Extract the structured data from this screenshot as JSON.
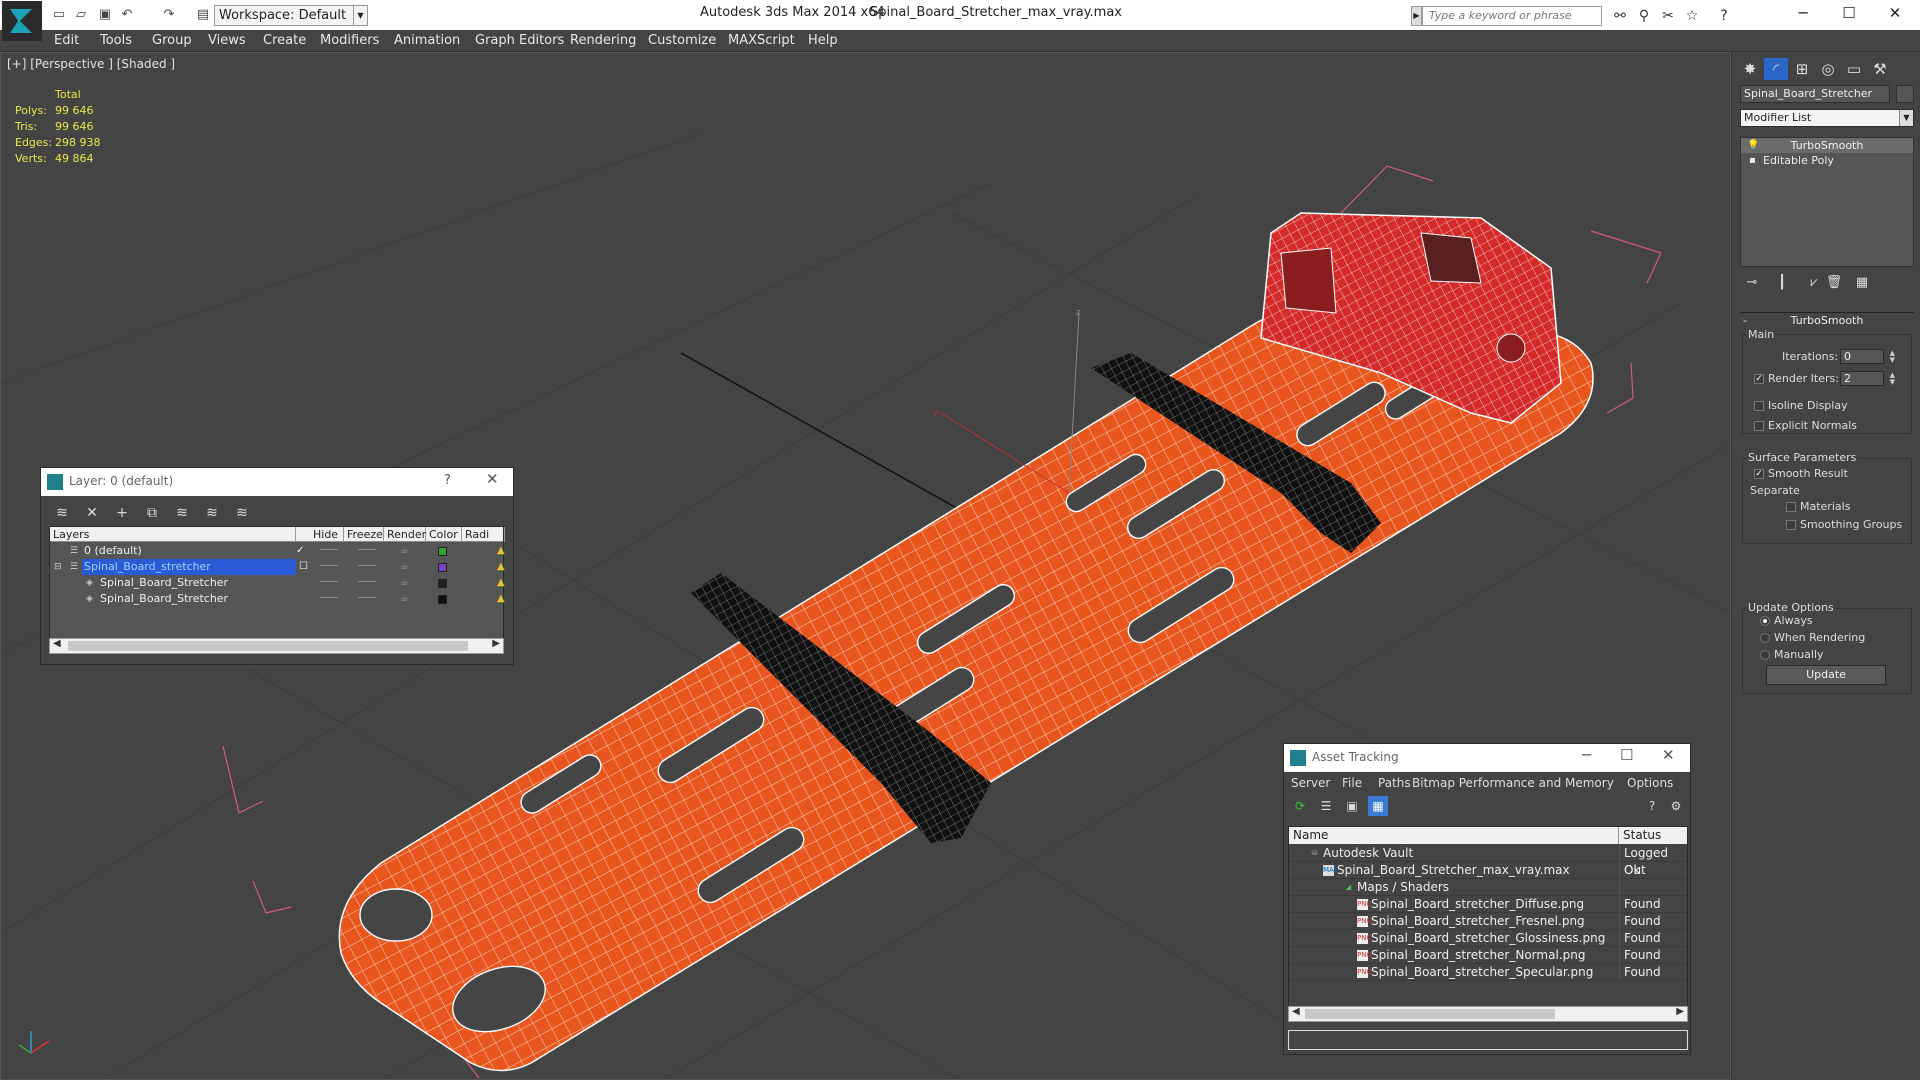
{
  "titlebar": {
    "app_title": "Autodesk 3ds Max  2014 x64",
    "file_title": "Spinal_Board_Stretcher_max_vray.max",
    "workspace": "Workspace: Default",
    "search_placeholder": "Type a keyword or phrase"
  },
  "menu": [
    "Edit",
    "Tools",
    "Group",
    "Views",
    "Create",
    "Modifiers",
    "Animation",
    "Graph Editors",
    "Rendering",
    "Customize",
    "MAXScript",
    "Help"
  ],
  "viewport": {
    "label": "[+] [Perspective ] [Shaded ]",
    "stats": {
      "header": "Total",
      "rows": [
        {
          "k": "Polys:",
          "v": "99 646"
        },
        {
          "k": "Tris:",
          "v": "99 646"
        },
        {
          "k": "Edges:",
          "v": "298 938"
        },
        {
          "k": "Verts:",
          "v": "49 864"
        }
      ]
    },
    "colors": {
      "board": "#e8561e",
      "wire": "#ffffff",
      "handle": "#d42a2a",
      "strap": "#111111",
      "grid": "#2a2a2a",
      "bbox": "#d05a8a"
    }
  },
  "command_panel": {
    "object_name": "Spinal_Board_Stretcher",
    "modifier_list": "Modifier List",
    "stack": [
      "TurboSmooth",
      "Editable Poly"
    ],
    "rollout": "TurboSmooth",
    "main": {
      "label": "Main",
      "iterations_label": "Iterations:",
      "iterations": "0",
      "render_iters_label": "Render Iters:",
      "render_iters": "2",
      "isoline": "Isoline Display",
      "explicit": "Explicit Normals"
    },
    "surface": {
      "label": "Surface Parameters",
      "smooth_result": "Smooth Result",
      "separate": "Separate",
      "materials": "Materials",
      "smoothing_groups": "Smoothing Groups"
    },
    "update_options": {
      "label": "Update Options",
      "always": "Always",
      "when_rendering": "When Rendering",
      "manually": "Manually",
      "update_btn": "Update"
    }
  },
  "layer_dialog": {
    "title": "Layer: 0 (default)",
    "help": "?",
    "columns": [
      "Layers",
      "Hide",
      "Freeze",
      "Render",
      "Color",
      "Radi"
    ],
    "rows": [
      {
        "name": "0 (default)",
        "color": "#2fa52f",
        "indent": 0
      },
      {
        "name": "Spinal_Board_stretcher",
        "color": "#7a3fc9",
        "indent": 0
      },
      {
        "name": "Spinal_Board_Stretcher",
        "color": "#222222",
        "indent": 1
      },
      {
        "name": "Spinal_Board_Stretcher",
        "color": "#111111",
        "indent": 1
      }
    ]
  },
  "asset_dialog": {
    "title": "Asset Tracking",
    "menu": [
      "Server",
      "File",
      "Paths",
      "Bitmap Performance and Memory",
      "Options"
    ],
    "columns": [
      "Name",
      "Status"
    ],
    "rows": [
      {
        "name": "Autodesk Vault",
        "status": "Logged Out",
        "indent": 1,
        "icon": "vault-icon"
      },
      {
        "name": "Spinal_Board_Stretcher_max_vray.max",
        "status": "Ok",
        "indent": 2,
        "icon": "max-file-icon"
      },
      {
        "name": "Maps / Shaders",
        "status": "",
        "indent": 3,
        "icon": "maps-icon"
      },
      {
        "name": "Spinal_Board_stretcher_Diffuse.png",
        "status": "Found",
        "indent": 4,
        "icon": "png-icon"
      },
      {
        "name": "Spinal_Board_stretcher_Fresnel.png",
        "status": "Found",
        "indent": 4,
        "icon": "png-icon"
      },
      {
        "name": "Spinal_Board_stretcher_Glossiness.png",
        "status": "Found",
        "indent": 4,
        "icon": "png-icon"
      },
      {
        "name": "Spinal_Board_stretcher_Normal.png",
        "status": "Found",
        "indent": 4,
        "icon": "png-icon"
      },
      {
        "name": "Spinal_Board_stretcher_Specular.png",
        "status": "Found",
        "indent": 4,
        "icon": "png-icon"
      }
    ]
  }
}
